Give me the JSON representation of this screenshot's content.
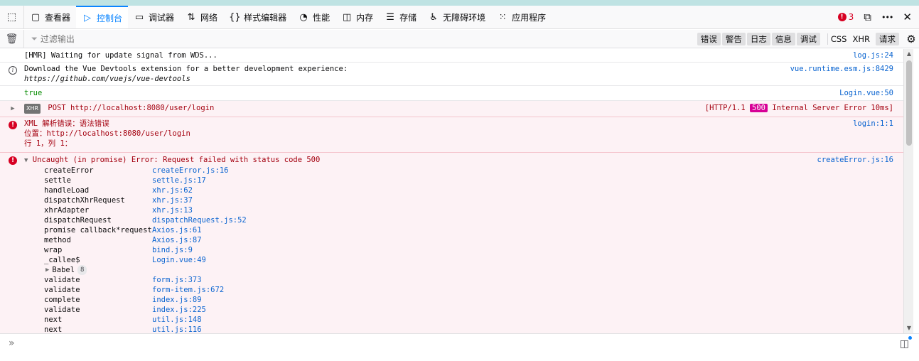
{
  "tabs": [
    {
      "label": "查看器",
      "icon": "inspector-icon",
      "glyph": "▢"
    },
    {
      "label": "控制台",
      "icon": "console-icon",
      "glyph": "▷",
      "active": true
    },
    {
      "label": "调试器",
      "icon": "debugger-icon",
      "glyph": "▭"
    },
    {
      "label": "网络",
      "icon": "network-icon",
      "glyph": "⇅"
    },
    {
      "label": "样式编辑器",
      "icon": "style-editor-icon",
      "glyph": "{}"
    },
    {
      "label": "性能",
      "icon": "performance-icon",
      "glyph": "◔"
    },
    {
      "label": "内存",
      "icon": "memory-icon",
      "glyph": "◫"
    },
    {
      "label": "存储",
      "icon": "storage-icon",
      "glyph": "☰"
    },
    {
      "label": "无障碍环境",
      "icon": "accessibility-icon",
      "glyph": "♿"
    },
    {
      "label": "应用程序",
      "icon": "application-icon",
      "glyph": "⁙"
    }
  ],
  "toolbar": {
    "error_count": "3",
    "dock_icon": "⧉",
    "more_icon": "•••",
    "close_icon": "✕"
  },
  "filter": {
    "placeholder": "过滤输出",
    "levels": [
      "错误",
      "警告",
      "日志",
      "信息",
      "调试"
    ],
    "extras": [
      "CSS",
      "XHR",
      "请求"
    ]
  },
  "messages": {
    "hmr": {
      "text": "[HMR] Waiting for update signal from WDS...",
      "loc": "log.js:24"
    },
    "devtools": {
      "line1": "Download the Vue Devtools extension for a better development experience:",
      "line2": "https://github.com/vuejs/vue-devtools",
      "loc": "vue.runtime.esm.js:8429"
    },
    "true_log": {
      "text": "true",
      "loc": "Login.vue:50"
    },
    "xhr": {
      "badge": "XHR",
      "method_url": "POST http://localhost:8080/user/login",
      "status_pre": "[HTTP/1.1",
      "status_code": "500",
      "status_post": "Internal Server Error 10ms]"
    },
    "xml_error": {
      "line1": "XML 解析错误：语法错误",
      "line2": "位置：http://localhost:8080/user/login",
      "line3": "行 1，列 1：",
      "loc": "login:1:1"
    },
    "uncaught": {
      "text": "Uncaught (in promise) Error: Request failed with status code 500",
      "loc": "createError.js:16",
      "frames_a": [
        {
          "fn": "createError",
          "src": "createError.js:16"
        },
        {
          "fn": "settle",
          "src": "settle.js:17"
        },
        {
          "fn": "handleLoad",
          "src": "xhr.js:62"
        },
        {
          "fn": "dispatchXhrRequest",
          "src": "xhr.js:37"
        },
        {
          "fn": "xhrAdapter",
          "src": "xhr.js:13"
        },
        {
          "fn": "dispatchRequest",
          "src": "dispatchRequest.js:52"
        },
        {
          "fn": "promise callback*request",
          "src": "Axios.js:61"
        },
        {
          "fn": "method",
          "src": "Axios.js:87"
        },
        {
          "fn": "wrap",
          "src": "bind.js:9"
        },
        {
          "fn": "_callee$",
          "src": "Login.vue:49"
        }
      ],
      "babel": {
        "label": "Babel",
        "count": "8"
      },
      "frames_b": [
        {
          "fn": "validate",
          "src": "form.js:373"
        },
        {
          "fn": "validate",
          "src": "form-item.js:672"
        },
        {
          "fn": "complete",
          "src": "index.js:89"
        },
        {
          "fn": "validate",
          "src": "index.js:225"
        },
        {
          "fn": "next",
          "src": "util.js:148"
        },
        {
          "fn": "next",
          "src": "util.js:116"
        }
      ]
    }
  },
  "colors": {
    "accent": "#0a84ff",
    "error": "#d70022",
    "error_bg": "#fdf2f5",
    "link": "#0a64d0",
    "status_500": "#d70096"
  }
}
